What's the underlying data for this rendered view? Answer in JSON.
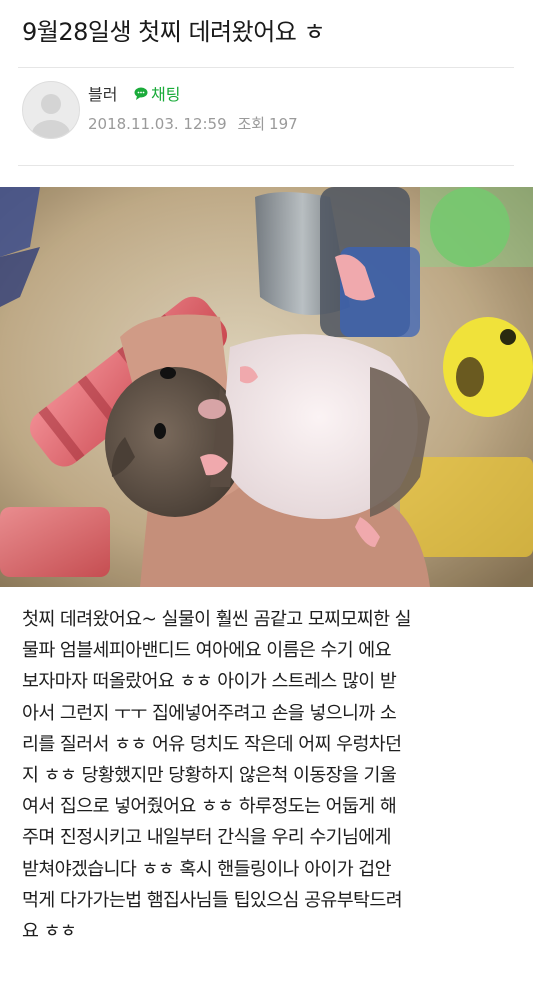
{
  "post": {
    "title": "9월28일생 첫찌 데려왔어요 ㅎ",
    "author": "블러",
    "chat_label": "채팅",
    "date": "2018.11.03. 12:59",
    "views_label": "조회",
    "views": "197"
  },
  "icons": {
    "avatar": "default-user-avatar-icon",
    "chat": "chat-bubble-icon"
  },
  "colors": {
    "chat_accent": "#1aab3a",
    "meta_gray": "#9a9a9a"
  },
  "body_lines": [
    "첫찌 데려왔어요~ 실물이 훨씬 곰같고 모찌모찌한 실",
    "물파 엄블세피아밴디드 여아에요 이름은 수기 에요",
    "보자마자 떠올랐어요 ㅎㅎ 아이가 스트레스 많이 받",
    "아서 그런지 ㅜㅜ 집에넣어주려고 손을 넣으니까 소",
    "리를 질러서 ㅎㅎ 어유 덩치도 작은데 어찌 우렁차던",
    "지 ㅎㅎ 당황했지만 당황하지 않은척 이동장을 기울",
    "여서 집으로 넣어줬어요 ㅎㅎ 하루정도는 어둡게 해",
    "주며 진정시키고 내일부터 간식을 우리 수기님에게",
    "받쳐야겠습니다 ㅎㅎ 혹시 핸들링이나 아이가 겁안",
    "먹게 다가가는법 햄집사님들 팁있으심 공유부탁드려",
    "요 ㅎㅎ"
  ]
}
